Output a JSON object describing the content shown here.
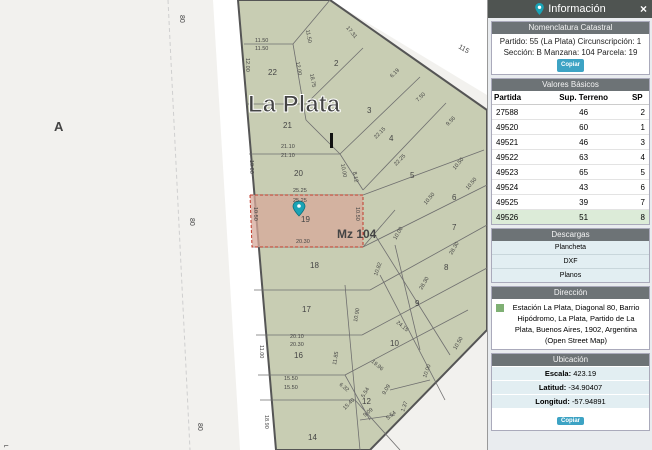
{
  "map": {
    "area_label": "A",
    "city_label": "La Plata",
    "block_label": "Mz 104",
    "street_number_labels": [
      "80",
      "80",
      "80"
    ],
    "corner_label": "115",
    "parcel_numbers": [
      "1",
      "2",
      "3",
      "4",
      "5",
      "6",
      "7",
      "8",
      "9",
      "10",
      "11",
      "12",
      "13 A",
      "14",
      "16",
      "17",
      "18",
      "19",
      "20",
      "21",
      "22"
    ],
    "dimension_labels": [
      "11.50",
      "11.50",
      "12.00",
      "11.50",
      "17.31",
      "12.00",
      "18.75",
      "21.10",
      "21.10",
      "10.00",
      "25.25",
      "25.25",
      "10.50",
      "10.50",
      "20.30",
      "10.00",
      "8.12",
      "22.15",
      "22.25",
      "6.19",
      "7.50",
      "9.56",
      "10.50",
      "10.50",
      "10.50",
      "10.00",
      "28.30",
      "10.82",
      "28.30",
      "10.90",
      "20.10",
      "20.30",
      "11.00",
      "11.85",
      "24.15",
      "19.96",
      "15.50",
      "15.50",
      "6.32",
      "15.40",
      "5.54",
      "9.09",
      "9.09",
      "5.54",
      "1.37",
      "10.00",
      "18.90",
      "10.50"
    ]
  },
  "panel": {
    "title": "Información",
    "close_label": "×",
    "pin_icon": "map-pin-icon",
    "nomenclatura": {
      "title": "Nomenclatura Catastral",
      "line1": "Partido: 55 (La Plata) Circunscripción: 1",
      "line2": "Sección: B Manzana: 104 Parcela: 19",
      "copy_label": "Copiar"
    },
    "valores": {
      "title": "Valores Básicos",
      "headers": [
        "Partida",
        "Sup. Terreno",
        "SP"
      ],
      "rows": [
        [
          "27588",
          "46",
          "2"
        ],
        [
          "49520",
          "60",
          "1"
        ],
        [
          "49521",
          "46",
          "3"
        ],
        [
          "49522",
          "63",
          "4"
        ],
        [
          "49523",
          "65",
          "5"
        ],
        [
          "49524",
          "43",
          "6"
        ],
        [
          "49525",
          "39",
          "7"
        ],
        [
          "49526",
          "51",
          "8"
        ]
      ]
    },
    "descargas": {
      "title": "Descargas",
      "items": [
        "Plancheta",
        "DXF",
        "Planos"
      ]
    },
    "direccion": {
      "title": "Dirección",
      "text": "Estación La Plata, Diagonal 80, Barrio Hipódromo, La Plata, Partido de La Plata, Buenos Aires, 1902, Argentina (Open Street Map)"
    },
    "ubicacion": {
      "title": "Ubicación",
      "escala_label": "Escala:",
      "escala_value": "423.19",
      "latitud_label": "Latitud:",
      "latitud_value": "-34.90407",
      "longitud_label": "Longitud:",
      "longitud_value": "-57.94891",
      "copy_label": "Copiar"
    }
  },
  "colors": {
    "block_fill": "#c8cdb3",
    "selected_parcel": "#d7a89a",
    "road": "#ffffff",
    "panel_header": "#4f5451",
    "accent": "#3da3c4"
  }
}
